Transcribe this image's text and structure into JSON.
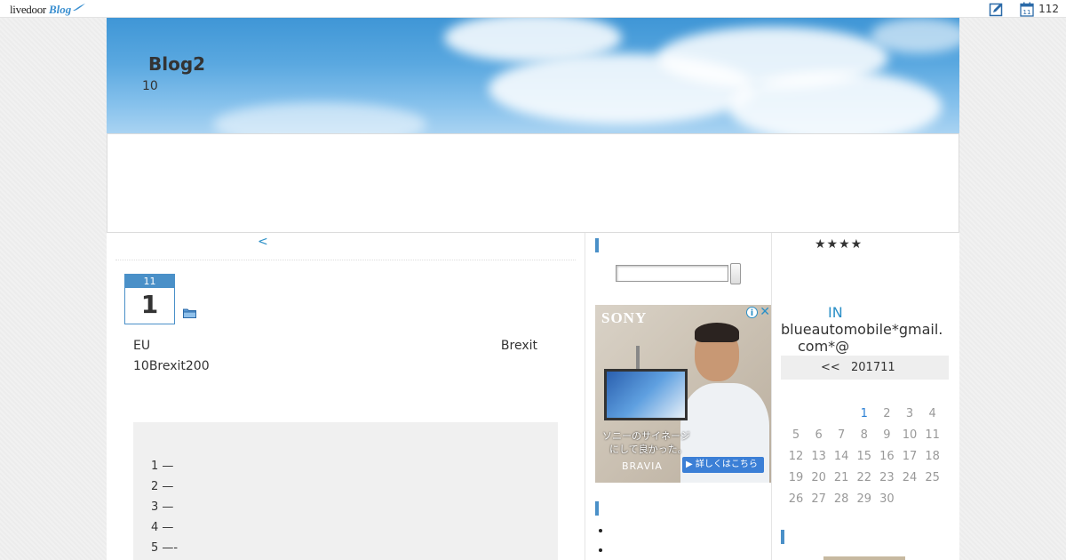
{
  "topbar": {
    "logo_livedoor": "livedoor",
    "logo_blog": "Blog",
    "calendar_icon_day": "11",
    "count": "112"
  },
  "blog": {
    "title": "Blog2",
    "subtitle": "10"
  },
  "article": {
    "pager": "<",
    "date_month": "11",
    "date_day": "1",
    "line1_left": "EU",
    "line1_right": "Brexit",
    "line2": "10Brexit200",
    "toc": [
      "1 —",
      "2 —",
      "3 —",
      "4 —",
      "5 —-"
    ]
  },
  "ad": {
    "brand": "SONY",
    "info": "i",
    "close": "✕",
    "copy_line1": "ソニーのサイネージ",
    "copy_line2": "にして良かった。",
    "product": "BRAVIA",
    "cta": "▶ 詳しくはこちら",
    "brand_color": "#3b7fd6"
  },
  "sidebar_right": {
    "stars": "★★★★",
    "contact_in": "IN",
    "mail_line1": "blueautomobile*gmail.",
    "mail_line2": "com*@",
    "calendar": {
      "prev": "<<",
      "month": "201711",
      "weeks": [
        [
          "",
          "",
          "",
          "1",
          "2",
          "3",
          "4"
        ],
        [
          "5",
          "6",
          "7",
          "8",
          "9",
          "10",
          "11"
        ],
        [
          "12",
          "13",
          "14",
          "15",
          "16",
          "17",
          "18"
        ],
        [
          "19",
          "20",
          "21",
          "22",
          "23",
          "24",
          "25"
        ],
        [
          "26",
          "27",
          "28",
          "29",
          "30",
          "",
          ""
        ]
      ],
      "linked_day": "1"
    }
  },
  "colors": {
    "accent": "#4a90c8",
    "link": "#2a8fc7",
    "header_sky": "#5aa8e0"
  }
}
